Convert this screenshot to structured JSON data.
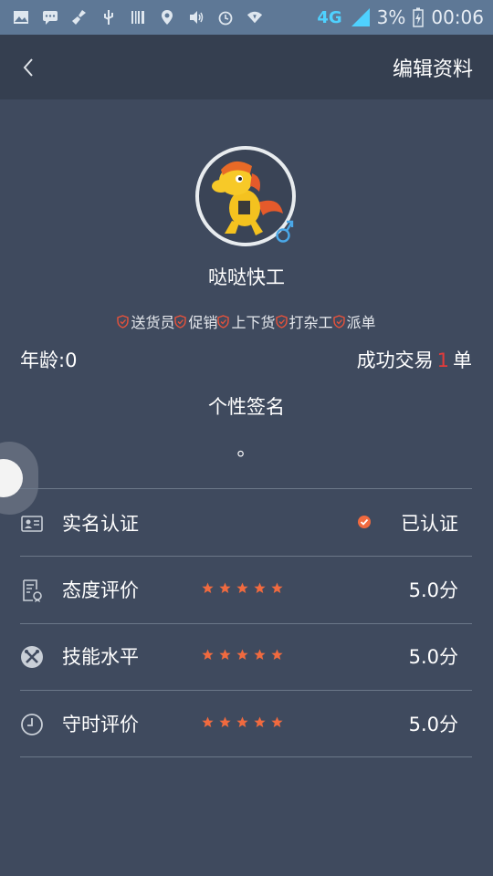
{
  "status_bar": {
    "network": "4G",
    "battery": "3%",
    "time": "00:06"
  },
  "header": {
    "edit_label": "编辑资料"
  },
  "profile": {
    "name": "哒哒快工",
    "tags": [
      "送货员",
      "促销",
      "上下货",
      "打杂工",
      "派单"
    ],
    "age_text": "年龄:0",
    "deals_prefix": "成功交易",
    "deals_count": "1",
    "deals_suffix": "单",
    "signature_title": "个性签名",
    "signature_text": "。"
  },
  "rows": {
    "verification": {
      "label": "实名认证",
      "value": "已认证"
    },
    "attitude": {
      "label": "态度评价",
      "value": "5.0分",
      "stars": 5
    },
    "skill": {
      "label": "技能水平",
      "value": "5.0分",
      "stars": 5
    },
    "punctuality": {
      "label": "守时评价",
      "value": "5.0分",
      "stars": 5
    }
  },
  "colors": {
    "background": "#3f4a5e",
    "topbar": "#353f50",
    "accent": "#f06a3f",
    "deal_count": "#e23b3b"
  }
}
